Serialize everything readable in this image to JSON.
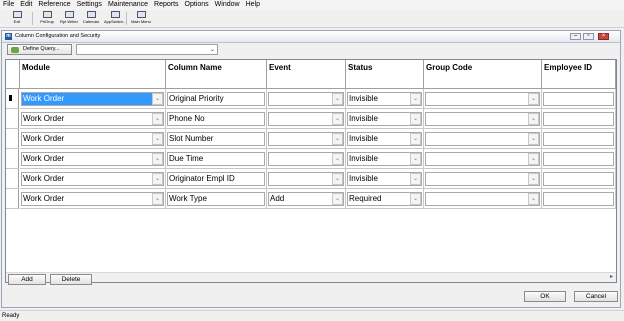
{
  "menu": [
    "File",
    "Edit",
    "Reference",
    "Settings",
    "Maintenance",
    "Reports",
    "Options",
    "Window",
    "Help"
  ],
  "toolbar": [
    {
      "label": "Exit",
      "icon": "exit-icon"
    },
    {
      "label": "PriGrup",
      "icon": "priority-group-icon"
    },
    {
      "label": "Rpt Writer",
      "icon": "report-writer-icon"
    },
    {
      "label": "Calendar",
      "icon": "calendar-icon"
    },
    {
      "label": "AppSwitch...",
      "icon": "app-switch-icon"
    },
    {
      "label": "Main Menu",
      "icon": "main-menu-icon"
    }
  ],
  "window": {
    "title": "Column Configuration and Security"
  },
  "filter": {
    "define_query_label": "Define Query...",
    "query_value": ""
  },
  "columns": [
    "Module",
    "Column Name",
    "Event",
    "Status",
    "Group Code",
    "Employee ID"
  ],
  "rows": [
    {
      "module": "Work Order",
      "column_name": "Original Priority",
      "event": "",
      "status": "Invisible",
      "group_code": "",
      "employee_id": ""
    },
    {
      "module": "Work Order",
      "column_name": "Phone No",
      "event": "",
      "status": "Invisible",
      "group_code": "",
      "employee_id": ""
    },
    {
      "module": "Work Order",
      "column_name": "Slot Number",
      "event": "",
      "status": "Invisible",
      "group_code": "",
      "employee_id": ""
    },
    {
      "module": "Work Order",
      "column_name": "Due Time",
      "event": "",
      "status": "Invisible",
      "group_code": "",
      "employee_id": ""
    },
    {
      "module": "Work Order",
      "column_name": "Originator Empl ID",
      "event": "",
      "status": "Invisible",
      "group_code": "",
      "employee_id": ""
    },
    {
      "module": "Work Order",
      "column_name": "Work Type",
      "event": "Add",
      "status": "Required",
      "group_code": "",
      "employee_id": ""
    }
  ],
  "buttons": {
    "add": "Add",
    "delete": "Delete",
    "ok": "OK",
    "cancel": "Cancel"
  },
  "status": "Ready"
}
